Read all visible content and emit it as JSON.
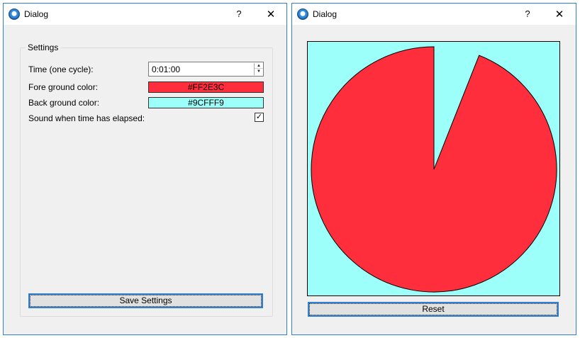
{
  "settings_dialog": {
    "title": "Dialog",
    "help": "?",
    "close": "✕",
    "group_title": "Settings",
    "time_label": "Time (one cycle):",
    "time_value": "0:01:00",
    "fore_label": "Fore ground color:",
    "fore_value": "#FF2E3C",
    "back_label": "Back ground color:",
    "back_value": "#9CFFF9",
    "sound_label": "Sound when time has elapsed:",
    "sound_checked": true,
    "save_label": "Save Settings"
  },
  "timer_dialog": {
    "title": "Dialog",
    "help": "?",
    "close": "✕",
    "elapsed_fraction": 0.06,
    "fore_color": "#FF2E3C",
    "back_color": "#9CFFF9",
    "reset_label": "Reset"
  }
}
